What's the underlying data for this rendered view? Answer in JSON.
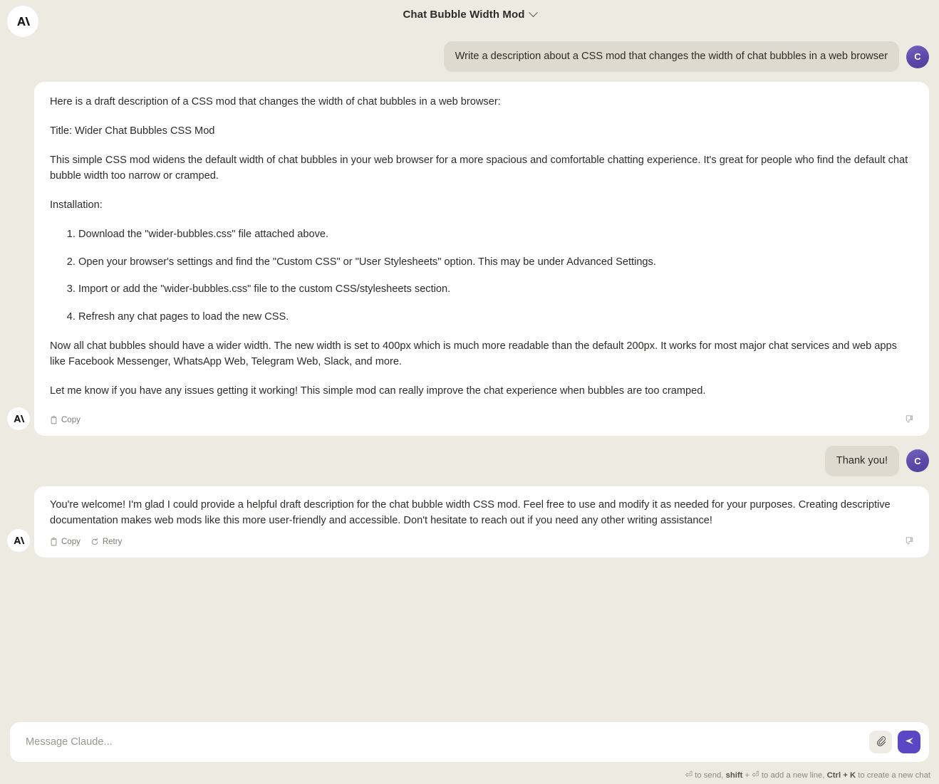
{
  "header": {
    "logo_icon": "anthropic-logo-icon",
    "title": "Chat Bubble Width Mod",
    "chevron_icon": "chevron-down-icon"
  },
  "colors": {
    "page_background": "#edeae2",
    "card_background": "#ffffff",
    "user_bubble": "#dedacf",
    "accent_purple": "#5b46c4",
    "avatar_purple": "#5b4aa8",
    "text": "#2e2c29",
    "muted_text": "#7d7a74"
  },
  "messages": [
    {
      "role": "user",
      "avatar_letter": "C",
      "text": "Write a description about a CSS mod that changes the width of chat bubbles in a web browser"
    },
    {
      "role": "assistant",
      "paragraphs_before_list": [
        "Here is a draft description of a CSS mod that changes the width of chat bubbles in a web browser:",
        "Title: Wider Chat Bubbles CSS Mod",
        "This simple CSS mod widens the default width of chat bubbles in your web browser for a more spacious and comfortable chatting experience. It's great for people who find the default chat bubble width too narrow or cramped.",
        "Installation:"
      ],
      "list_items": [
        "Download the \"wider-bubbles.css\" file attached above.",
        "Open your browser's settings and find the \"Custom CSS\" or \"User Stylesheets\" option. This may be under Advanced Settings.",
        "Import or add the \"wider-bubbles.css\" file to the custom CSS/stylesheets section.",
        "Refresh any chat pages to load the new CSS."
      ],
      "paragraphs_after_list": [
        "Now all chat bubbles should have a wider width. The new width is set to 400px which is much more readable than the default 200px. It works for most major chat services and web apps like Facebook Messenger, WhatsApp Web, Telegram Web, Slack, and more.",
        "Let me know if you have any issues getting it working! This simple mod can really improve the chat experience when bubbles are too cramped."
      ],
      "actions": {
        "copy_label": "Copy",
        "copy_icon": "clipboard-icon",
        "feedback_icon": "thumbs-down-icon"
      }
    },
    {
      "role": "user",
      "avatar_letter": "C",
      "text": "Thank you!"
    },
    {
      "role": "assistant",
      "paragraphs": [
        "You're welcome! I'm glad I could provide a helpful draft description for the chat bubble width CSS mod. Feel free to use and modify it as needed for your purposes. Creating descriptive documentation makes web mods like this more user-friendly and accessible. Don't hesitate to reach out if you need any other writing assistance!"
      ],
      "actions": {
        "copy_label": "Copy",
        "copy_icon": "clipboard-icon",
        "retry_label": "Retry",
        "retry_icon": "refresh-icon",
        "feedback_icon": "thumbs-down-icon"
      }
    }
  ],
  "composer": {
    "placeholder": "Message Claude...",
    "value": "",
    "attach_icon": "paperclip-icon",
    "send_icon": "send-arrow-icon"
  },
  "footer": {
    "hint_return_1": "⏎",
    "hint_text_1": " to send, ",
    "hint_bold_1": "shift",
    "hint_text_2": " + ",
    "hint_return_2": "⏎",
    "hint_text_3": " to add a new line, ",
    "hint_bold_2": "Ctrl + K",
    "hint_text_4": " to create a new chat"
  }
}
